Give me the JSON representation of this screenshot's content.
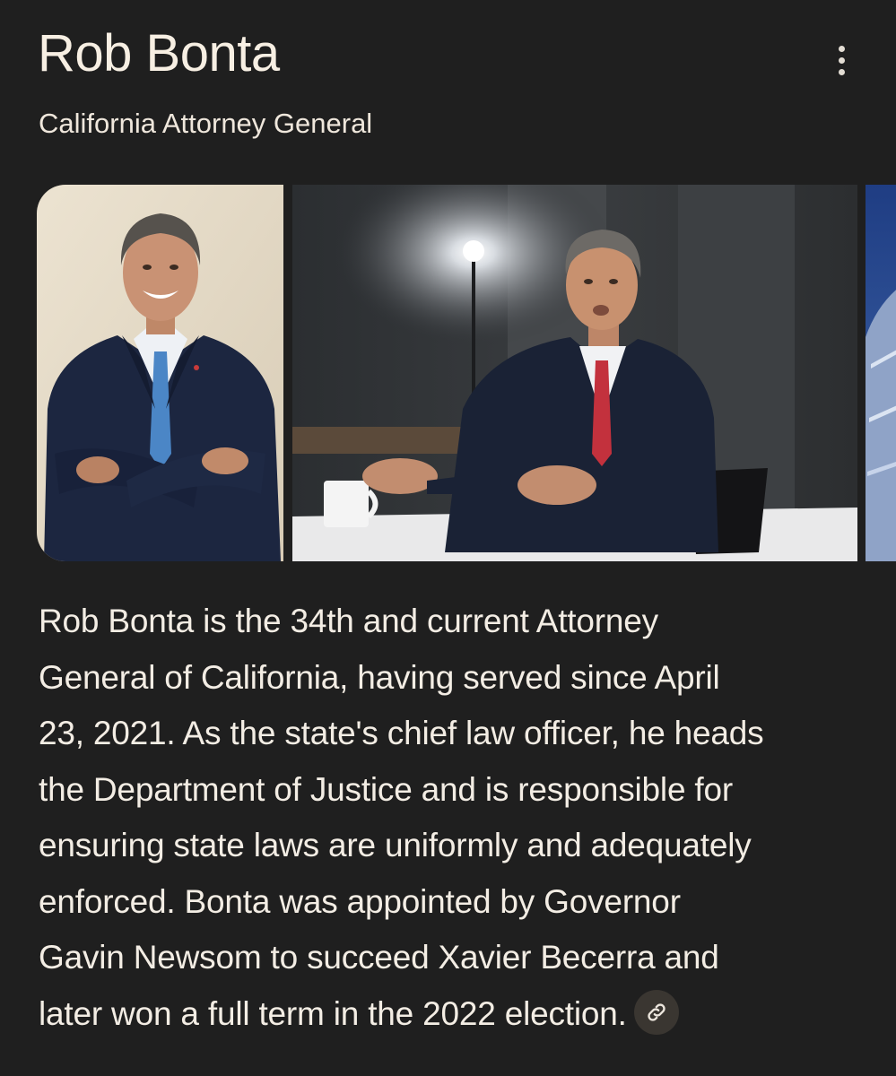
{
  "header": {
    "title": "Rob Bonta",
    "subtitle": "California Attorney General"
  },
  "menu": {
    "icon": "more-vert-icon"
  },
  "images": [
    {
      "label": "portrait-photo"
    },
    {
      "label": "interview-photo"
    },
    {
      "label": "building-photo"
    }
  ],
  "summary": {
    "lines": [
      "Rob Bonta is the 34th and current Attorney",
      "General of California, having served since April",
      "23, 2021. As the state's chief law officer, he heads",
      "the Department of Justice and is responsible for",
      "ensuring state laws are uniformly and adequately",
      "enforced. Bonta was appointed by Governor",
      "Gavin Newsom to succeed Xavier Becerra and",
      "later won a full term in the 2022 election."
    ],
    "link_icon": "link-icon"
  },
  "colors": {
    "background": "#1f1f1f",
    "text": "#f3ede4",
    "chip": "#3a3631"
  }
}
